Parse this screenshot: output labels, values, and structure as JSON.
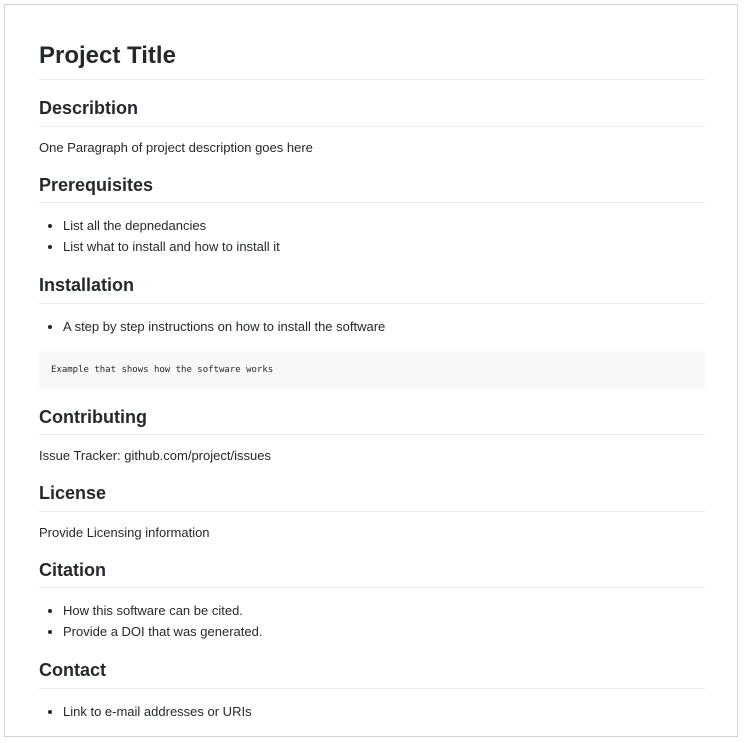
{
  "title": "Project Title",
  "sections": {
    "description": {
      "heading": "Describtion",
      "text": "One Paragraph of project description goes here"
    },
    "prerequisites": {
      "heading": "Prerequisites",
      "items": [
        "List all the depnedancies",
        "List what to install and how to install it"
      ]
    },
    "installation": {
      "heading": "Installation",
      "items": [
        "A step by step instructions on how to install the software"
      ],
      "code": "Example that shows how the software works"
    },
    "contributing": {
      "heading": "Contributing",
      "text": "Issue Tracker: github.com/project/issues"
    },
    "license": {
      "heading": "License",
      "text": "Provide Licensing information"
    },
    "citation": {
      "heading": "Citation",
      "items": [
        "How this software can be cited.",
        "Provide a DOI that was generated."
      ]
    },
    "contact": {
      "heading": "Contact",
      "items": [
        "Link to e-mail addresses or URIs"
      ]
    }
  }
}
